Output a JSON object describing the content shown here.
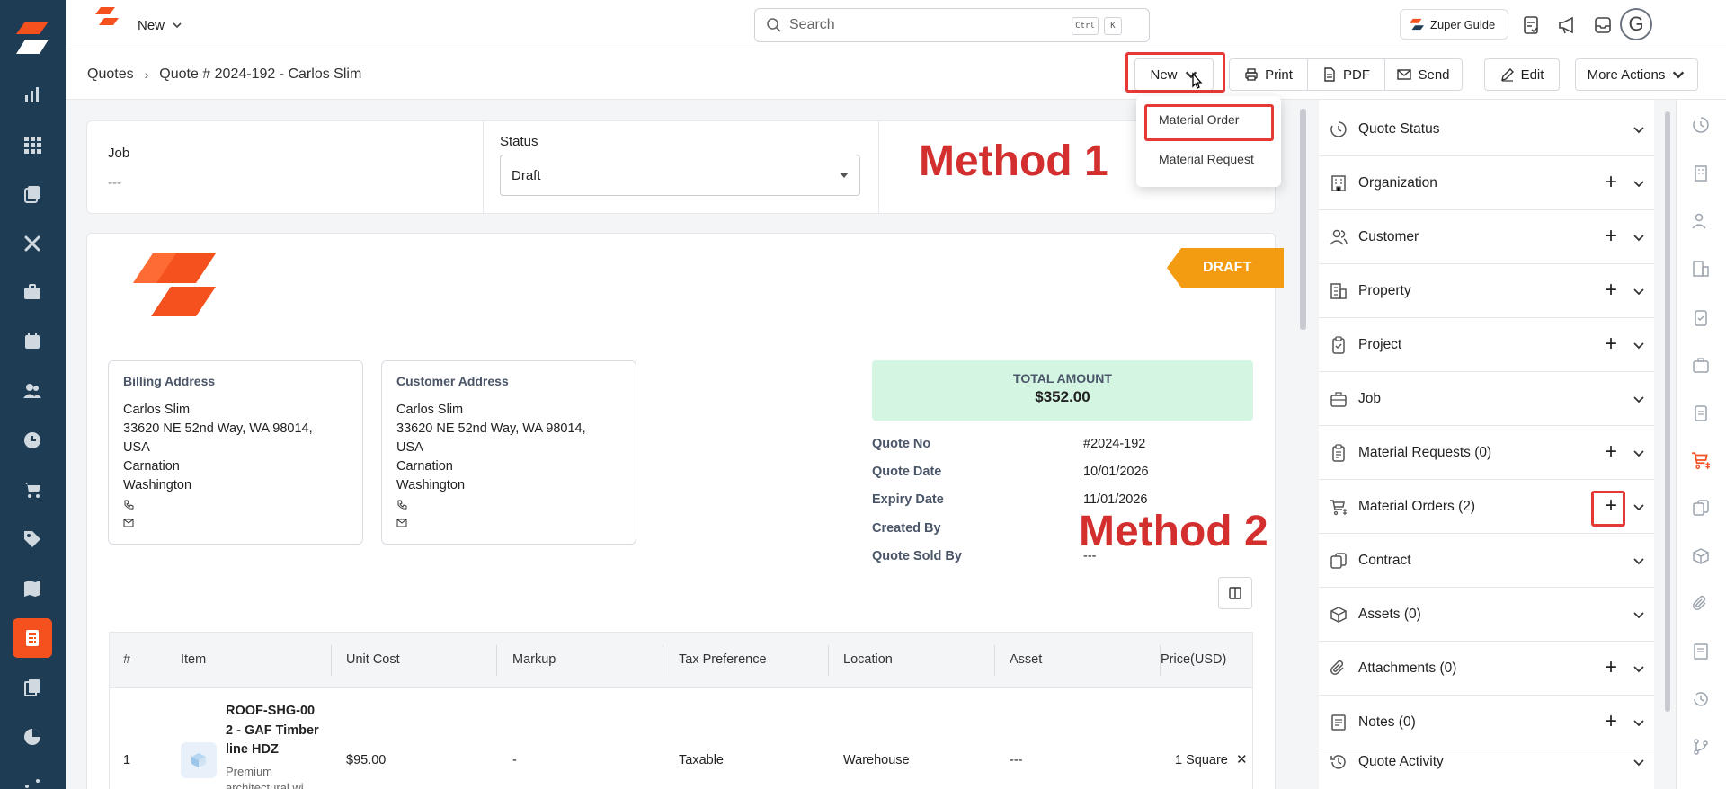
{
  "colors": {
    "brand": "#f4511e",
    "nav_bg": "#1f3c55",
    "highlight": "#e53935",
    "method_text": "#d32f2f",
    "draft_tag": "#f39c12",
    "total_bg": "#d4f5e2"
  },
  "nav": {
    "items": [
      "dashboard-icon",
      "apps-icon",
      "quotes-stack-icon",
      "tools-icon",
      "briefcase-icon",
      "calendar-icon",
      "users-icon",
      "clock-icon",
      "cart-icon",
      "tag-icon",
      "map-icon",
      "calculator-icon",
      "documents-icon",
      "pie-chart-icon",
      "more-icon"
    ],
    "active": "calculator-icon"
  },
  "topbar": {
    "new_label": "New",
    "search_placeholder": "Search",
    "kbd_ctrl": "Ctrl",
    "kbd_k": "K",
    "guide_label": "Zuper Guide",
    "avatar_initial": "G"
  },
  "breadcrumb": {
    "root": "Quotes",
    "current": "Quote # 2024-192 - Carlos Slim"
  },
  "actions": {
    "new": "New",
    "print": "Print",
    "pdf": "PDF",
    "send": "Send",
    "edit": "Edit",
    "more": "More Actions"
  },
  "new_menu": {
    "items": [
      "Material Order",
      "Material Request"
    ]
  },
  "annotations": {
    "method1": "Method 1",
    "method2": "Method 2"
  },
  "summary": {
    "job_label": "Job",
    "job_value": "---",
    "status_label": "Status",
    "status_value": "Draft"
  },
  "quote": {
    "draft_tag": "DRAFT",
    "billing": {
      "title": "Billing Address",
      "lines": [
        "Carlos Slim",
        "33620 NE 52nd Way, WA 98014,",
        "USA",
        "Carnation",
        "Washington"
      ]
    },
    "customer": {
      "title": "Customer Address",
      "lines": [
        "Carlos Slim",
        "33620 NE 52nd Way, WA 98014,",
        "USA",
        "Carnation",
        "Washington"
      ]
    },
    "total_label": "TOTAL AMOUNT",
    "total_value": "$352.00",
    "details": [
      {
        "label": "Quote No",
        "value": "#2024-192"
      },
      {
        "label": "Quote Date",
        "value": "10/01/2026"
      },
      {
        "label": "Expiry Date",
        "value": "11/01/2026"
      },
      {
        "label": "Created By",
        "value": ""
      },
      {
        "label": "Quote Sold By",
        "value": "---"
      }
    ]
  },
  "table": {
    "headers": [
      "#",
      "Item",
      "Unit Cost",
      "Markup",
      "Tax Preference",
      "Location",
      "Asset",
      "Price(USD)"
    ],
    "rows": [
      {
        "num": "1",
        "item_line1": "ROOF-SHG-00",
        "item_line2": "2 - GAF Timber",
        "item_line3": "line HDZ",
        "item_desc1": "Premium",
        "item_desc2": "architectural wi...",
        "unit_cost": "$95.00",
        "markup": "-",
        "tax": "Taxable",
        "location": "Warehouse",
        "asset": "---",
        "price": "1 Square"
      }
    ]
  },
  "right_panel": {
    "sections": [
      {
        "title": "Quote Status",
        "icon": "quote-status-icon",
        "plus": false
      },
      {
        "title": "Organization",
        "icon": "building-icon",
        "plus": true
      },
      {
        "title": "Customer",
        "icon": "users-icon",
        "plus": true
      },
      {
        "title": "Property",
        "icon": "property-icon",
        "plus": true
      },
      {
        "title": "Project",
        "icon": "clipboard-check-icon",
        "plus": true
      },
      {
        "title": "Job",
        "icon": "briefcase-icon",
        "plus": false
      },
      {
        "title": "Material Requests (0)",
        "icon": "clipboard-list-icon",
        "plus": true
      },
      {
        "title": "Material Orders (2)",
        "icon": "cart-dollar-icon",
        "plus": true
      },
      {
        "title": "Contract",
        "icon": "contract-icon",
        "plus": false
      },
      {
        "title": "Assets (0)",
        "icon": "cube-icon",
        "plus": false
      },
      {
        "title": "Attachments (0)",
        "icon": "paperclip-icon",
        "plus": true
      },
      {
        "title": "Notes (0)",
        "icon": "notes-icon",
        "plus": true
      },
      {
        "title": "Quote Activity",
        "icon": "history-icon",
        "plus": false
      }
    ]
  },
  "icon_strip": [
    "quote-status-icon",
    "building-icon",
    "users-icon",
    "property-icon",
    "clipboard-check-icon",
    "briefcase-icon",
    "clipboard-list-icon",
    "cart-dollar-icon",
    "contract-icon",
    "cube-icon",
    "paperclip-icon",
    "notes-icon",
    "history-icon",
    "git-branch-icon"
  ]
}
